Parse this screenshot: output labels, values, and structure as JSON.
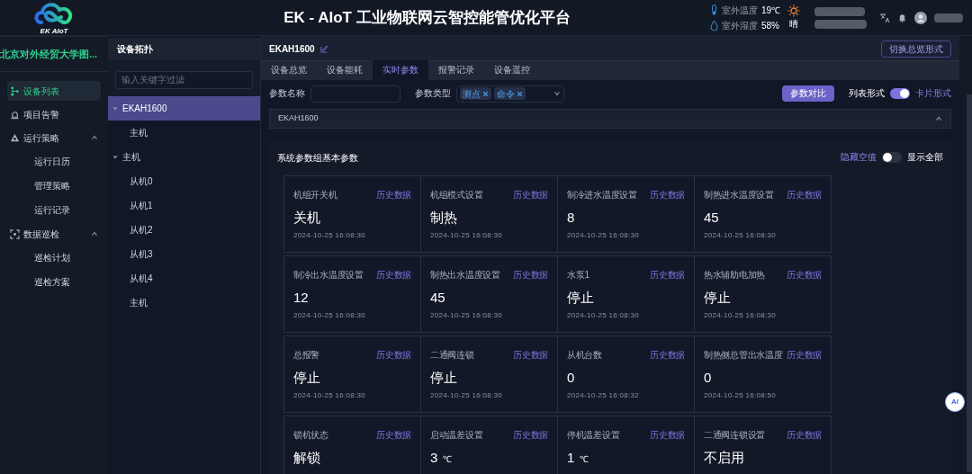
{
  "header": {
    "logo_text": "EK AIoT",
    "title": "EK - AIoT 工业物联网云智控能管优化平台",
    "weather": [
      {
        "kind": "temperature",
        "label": "室外温度",
        "value": "19℃"
      },
      {
        "kind": "humidity",
        "label": "室外湿度",
        "value": "58%"
      }
    ],
    "condition": "晴"
  },
  "sidebar": {
    "project": "北京对外经贸大学图...",
    "items": [
      {
        "label": "设备列表",
        "kind": "tree",
        "selected": true
      },
      {
        "label": "项目告警",
        "kind": "alarm",
        "selected": false
      },
      {
        "label": "运行策略",
        "kind": "strategy",
        "selected": false,
        "expanded": true,
        "children": [
          {
            "label": "运行日历",
            "selected": false
          },
          {
            "label": "管理策略",
            "selected": false
          },
          {
            "label": "运行记录",
            "selected": false
          }
        ]
      },
      {
        "label": "数据巡检",
        "kind": "scan",
        "selected": false,
        "expanded": true,
        "children": [
          {
            "label": "巡检计划",
            "selected": false
          },
          {
            "label": "巡检方案",
            "selected": false
          }
        ]
      }
    ]
  },
  "topology": {
    "title": "设备拓扑",
    "filter_placeholder": "输入关键字过滤",
    "tree": [
      {
        "label": "EKAH1600",
        "selected": true,
        "expanded": true,
        "children": [
          {
            "label": "主机",
            "selected": false
          }
        ]
      },
      {
        "label": "主机",
        "selected": false,
        "expanded": true,
        "children": [
          {
            "label": "从机0",
            "selected": false
          },
          {
            "label": "从机1",
            "selected": false
          },
          {
            "label": "从机2",
            "selected": false
          },
          {
            "label": "从机3",
            "selected": false
          },
          {
            "label": "从机4",
            "selected": false
          },
          {
            "label": "主机",
            "selected": false
          }
        ]
      }
    ]
  },
  "device": {
    "name": "EKAH1600",
    "switch_button": "切换总览形式",
    "tabs": [
      {
        "label": "设备总览",
        "selected": false
      },
      {
        "label": "设备能耗",
        "selected": false
      },
      {
        "label": "实时参数",
        "selected": true
      },
      {
        "label": "报警记录",
        "selected": false
      },
      {
        "label": "设备遥控",
        "selected": false
      }
    ],
    "filters": {
      "name_label": "参数名称",
      "type_label": "参数类型",
      "type_tags": [
        "测点",
        "命令"
      ]
    },
    "compare_button": "参数对比",
    "view_toggle": {
      "left": "列表形式",
      "right": "卡片形式",
      "on": true
    },
    "group": {
      "title": "EKAH1600",
      "expanded": true
    },
    "section": {
      "title": "系统参数组基本参数",
      "hide_empty_label": "隐藏空值",
      "hide_empty_on": false,
      "show_all_label": "显示全部"
    },
    "cards": [
      {
        "label": "机组开关机",
        "link": "历史数据",
        "value": "关机",
        "time": "2024-10-25 16:08:30"
      },
      {
        "label": "机组模式设置",
        "link": "历史数据",
        "value": "制热",
        "time": "2024-10-25 16:08:30"
      },
      {
        "label": "制冷进水温度设置",
        "link": "历史数据",
        "value": "8",
        "time": "2024-10-25 16:08:30"
      },
      {
        "label": "制热进水温度设置",
        "link": "历史数据",
        "value": "45",
        "time": "2024-10-25 16:08:30"
      },
      {
        "label": "制冷出水温度设置",
        "link": "历史数据",
        "value": "12",
        "time": "2024-10-25 16:08:30"
      },
      {
        "label": "制热出水温度设置",
        "link": "历史数据",
        "value": "45",
        "time": "2024-10-25 16:08:30"
      },
      {
        "label": "水泵1",
        "link": "历史数据",
        "value": "停止",
        "time": "2024-10-25 16:08:30"
      },
      {
        "label": "热水辅助电加热",
        "link": "历史数据",
        "value": "停止",
        "time": "2024-10-25 16:08:30"
      },
      {
        "label": "总报警",
        "link": "历史数据",
        "value": "停止",
        "time": "2024-10-25 16:08:30"
      },
      {
        "label": "二通阀连锁",
        "link": "历史数据",
        "value": "停止",
        "time": "2024-10-25 16:08:30"
      },
      {
        "label": "从机台数",
        "link": "历史数据",
        "value": "0",
        "time": "2024-10-25 16:08:32"
      },
      {
        "label": "制热侧总管出水温度",
        "link": "历史数据",
        "value": "0",
        "time": "2024-10-25 16:08:50"
      },
      {
        "label": "锁机状态",
        "link": "历史数据",
        "value": "解锁"
      },
      {
        "label": "启动温差设置",
        "link": "历史数据",
        "value": "3",
        "unit": "℃"
      },
      {
        "label": "停机温差设置",
        "link": "历史数据",
        "value": "1",
        "unit": "℃"
      },
      {
        "label": "二通阀连锁设置",
        "link": "历史数据",
        "value": "不启用"
      }
    ]
  },
  "assistant_button": "AI"
}
